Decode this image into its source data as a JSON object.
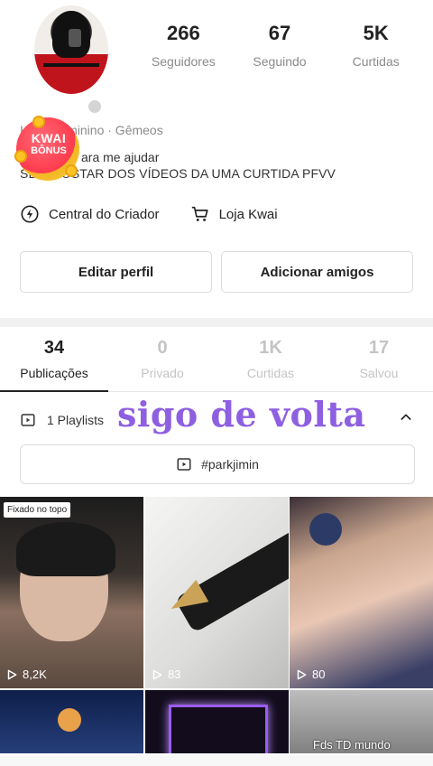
{
  "profile": {
    "stats": [
      {
        "value": "266",
        "label": "Seguidores"
      },
      {
        "value": "67",
        "label": "Seguindo"
      },
      {
        "value": "5K",
        "label": "Curtidas"
      }
    ],
    "info_line": "I...9 · Feminino · Gêmeos",
    "bio_line1": "ara me ajudar",
    "bio_line2": "SE... GOSTAR DOS VÍDEOS DA UMA CURTIDA PFVV",
    "kwai_badge": {
      "line1": "KWAI",
      "line2": "BÔNUS"
    }
  },
  "links": {
    "creator_center": "Central do Criador",
    "kwai_shop": "Loja Kwai"
  },
  "buttons": {
    "edit_profile": "Editar perfil",
    "add_friends": "Adicionar amigos"
  },
  "tabs": [
    {
      "count": "34",
      "label": "Publicações",
      "active": true
    },
    {
      "count": "0",
      "label": "Privado",
      "active": false
    },
    {
      "count": "1K",
      "label": "Curtidas",
      "active": false
    },
    {
      "count": "17",
      "label": "Salvou",
      "active": false
    }
  ],
  "playlists": {
    "label": "1 Playlists",
    "overlay_text": "sigo de volta",
    "tag": "#parkjimin"
  },
  "grid": {
    "pinned_label": "Fixado no topo",
    "items": [
      {
        "views": "8,2K"
      },
      {
        "views": "83"
      },
      {
        "views": "80"
      },
      {
        "caption": "Fds TD mundo"
      }
    ]
  },
  "colors": {
    "accent_purple": "#8e5fe0",
    "kwai_red": "#ff3a4e",
    "kwai_gold": "#ffc424"
  }
}
